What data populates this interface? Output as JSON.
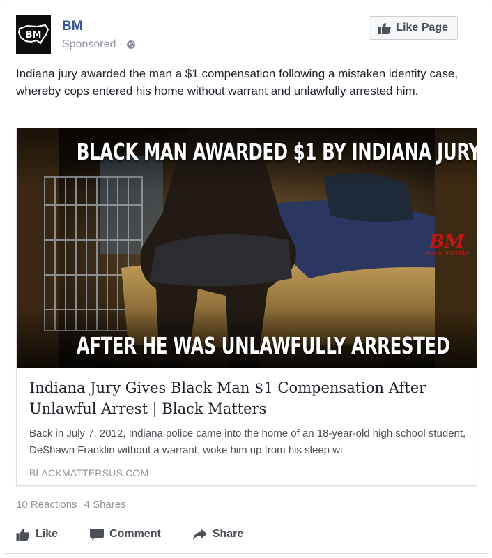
{
  "post": {
    "page_name": "BM",
    "sponsored_label": "Sponsored · ",
    "like_page_label": "Like Page",
    "text": "Indiana jury awarded the man a $1 compensation following a mistaken identity case, whereby cops entered his home without warrant and unlawfully arrested him."
  },
  "avatar": {
    "text": "BM"
  },
  "link": {
    "image_top_text": "BLACK MAN AWARDED $1 BY INDIANA JURY",
    "image_bottom_text": "AFTER HE WAS UNLAWFULLY ARRESTED",
    "watermark_big": "BM",
    "watermark_small": "BLACK MATTERS",
    "title": "Indiana Jury Gives Black Man $1 Compensation After Unlawful Arrest | Black Matters",
    "description": "Back in July 7, 2012, Indiana police came into the home of an 18-year-old high school student, DeShawn Franklin without a warrant, woke him up from his sleep wi",
    "domain": "BLACKMATTERSUS.COM"
  },
  "stats": {
    "reactions": "10 Reactions",
    "shares": "4 Shares"
  },
  "actions": {
    "like": "Like",
    "comment": "Comment",
    "share": "Share"
  },
  "colors": {
    "link_blue": "#365899",
    "muted_gray": "#90949c",
    "action_gray": "#4b4f56",
    "watermark_red": "#c11515"
  }
}
